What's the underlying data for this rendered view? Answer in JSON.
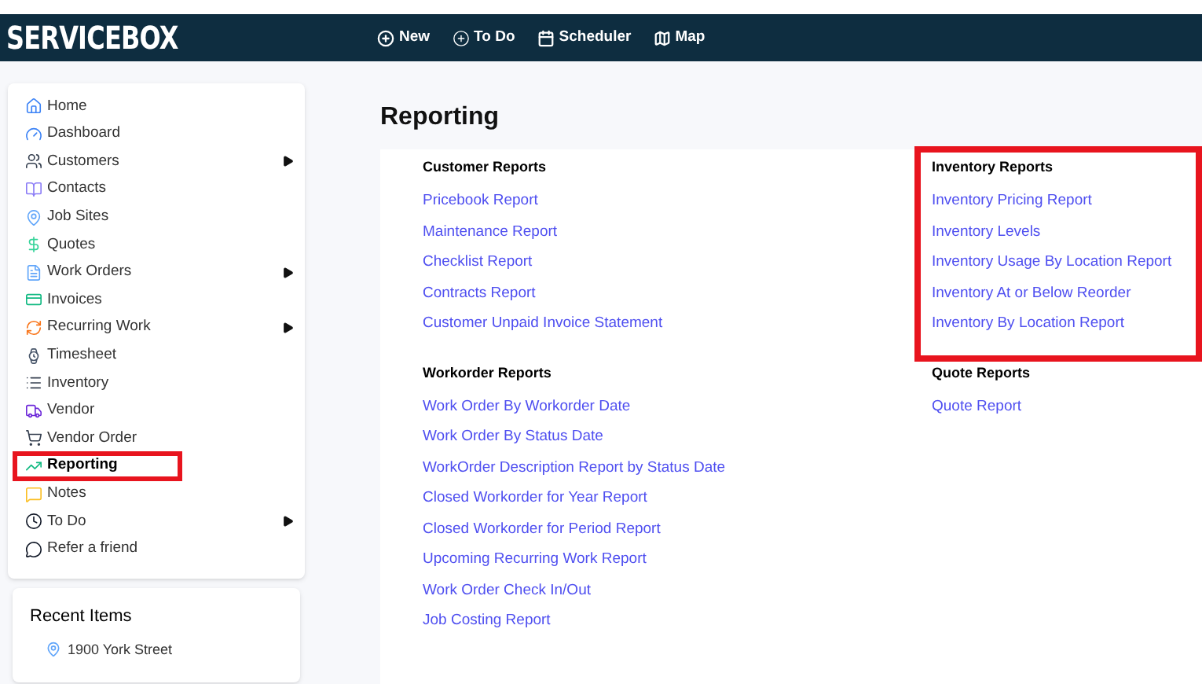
{
  "brand": "SERVICEBOX",
  "top_nav": [
    "New",
    "To Do",
    "Scheduler",
    "Map"
  ],
  "sidebar": {
    "items": [
      {
        "label": "Home",
        "selected": false,
        "expandable": false
      },
      {
        "label": "Dashboard",
        "selected": false,
        "expandable": false
      },
      {
        "label": "Customers",
        "selected": false,
        "expandable": true
      },
      {
        "label": "Contacts",
        "selected": false,
        "expandable": false
      },
      {
        "label": "Job Sites",
        "selected": false,
        "expandable": false
      },
      {
        "label": "Quotes",
        "selected": false,
        "expandable": false
      },
      {
        "label": "Work Orders",
        "selected": false,
        "expandable": true
      },
      {
        "label": "Invoices",
        "selected": false,
        "expandable": false
      },
      {
        "label": "Recurring Work",
        "selected": false,
        "expandable": true
      },
      {
        "label": "Timesheet",
        "selected": false,
        "expandable": false
      },
      {
        "label": "Inventory",
        "selected": false,
        "expandable": false
      },
      {
        "label": "Vendor",
        "selected": false,
        "expandable": false
      },
      {
        "label": "Vendor Order",
        "selected": false,
        "expandable": false
      },
      {
        "label": "Reporting",
        "selected": true,
        "expandable": false,
        "highlighted": true
      },
      {
        "label": "Notes",
        "selected": false,
        "expandable": false
      },
      {
        "label": "To Do",
        "selected": false,
        "expandable": true
      },
      {
        "label": "Refer a friend",
        "selected": false,
        "expandable": false
      }
    ]
  },
  "recent_items": {
    "title": "Recent Items",
    "items": [
      "1900 York Street"
    ]
  },
  "page_title": "Reporting",
  "sections": [
    {
      "title": "Customer Reports",
      "highlighted": false,
      "links": [
        "Pricebook Report",
        "Maintenance Report",
        "Checklist Report",
        "Contracts Report",
        "Customer Unpaid Invoice Statement"
      ]
    },
    {
      "title": "Inventory Reports",
      "highlighted": true,
      "links": [
        "Inventory Pricing Report",
        "Inventory Levels",
        "Inventory Usage By Location Report",
        "Inventory At or Below Reorder",
        "Inventory By Location Report"
      ]
    },
    {
      "title": "Workorder Reports",
      "highlighted": false,
      "links": [
        "Work Order By Workorder Date",
        "Work Order By Status Date",
        "WorkOrder Description Report by Status Date",
        "Closed Workorder for Year Report",
        "Closed Workorder for Period Report",
        "Upcoming Recurring Work Report",
        "Work Order Check In/Out",
        "Job Costing Report"
      ]
    },
    {
      "title": "Quote Reports",
      "highlighted": false,
      "links": [
        "Quote Report"
      ]
    }
  ]
}
